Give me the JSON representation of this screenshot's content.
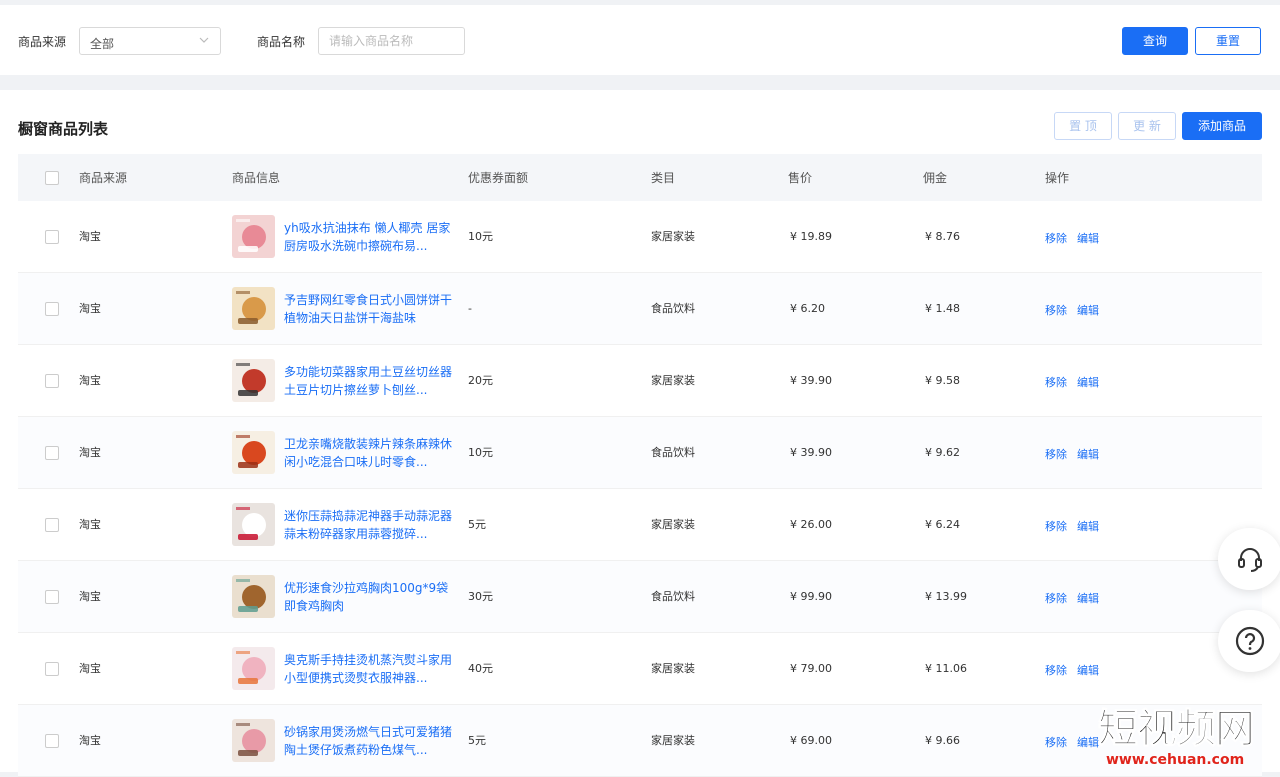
{
  "filter": {
    "source_label": "商品来源",
    "source_value": "全部",
    "name_label": "商品名称",
    "name_placeholder": "请输入商品名称",
    "query_button": "查询",
    "reset_button": "重置"
  },
  "list": {
    "title": "橱窗商品列表",
    "pin_button": "置 顶",
    "update_button": "更 新",
    "add_button": "添加商品"
  },
  "table": {
    "headers": [
      "商品来源",
      "商品信息",
      "优惠券面额",
      "类目",
      "售价",
      "佣金",
      "操作"
    ],
    "rows": [
      {
        "source": "淘宝",
        "name": "yh吸水抗油抹布 懒人椰壳 居家厨房吸水洗碗巾擦碗布易...",
        "coupon": "10元",
        "category": "家居家装",
        "price": "¥ 19.89",
        "commission": "¥ 8.76",
        "remove": "移除",
        "edit": "编辑"
      },
      {
        "source": "淘宝",
        "name": "予吉野网红零食日式小圆饼饼干植物油天日盐饼干海盐味",
        "coupon": "-",
        "category": "食品饮料",
        "price": "¥ 6.20",
        "commission": "¥ 1.48",
        "remove": "移除",
        "edit": "编辑"
      },
      {
        "source": "淘宝",
        "name": "多功能切菜器家用土豆丝切丝器土豆片切片擦丝萝卜刨丝...",
        "coupon": "20元",
        "category": "家居家装",
        "price": "¥ 39.90",
        "commission": "¥ 9.58",
        "remove": "移除",
        "edit": "编辑"
      },
      {
        "source": "淘宝",
        "name": "卫龙亲嘴烧散装辣片辣条麻辣休闲小吃混合口味儿时零食...",
        "coupon": "10元",
        "category": "食品饮料",
        "price": "¥ 39.90",
        "commission": "¥ 9.62",
        "remove": "移除",
        "edit": "编辑"
      },
      {
        "source": "淘宝",
        "name": "迷你压蒜捣蒜泥神器手动蒜泥器蒜末粉碎器家用蒜蓉搅碎...",
        "coupon": "5元",
        "category": "家居家装",
        "price": "¥ 26.00",
        "commission": "¥ 6.24",
        "remove": "移除",
        "edit": "编辑"
      },
      {
        "source": "淘宝",
        "name": "优形速食沙拉鸡胸肉100g*9袋即食鸡胸肉",
        "coupon": "30元",
        "category": "食品饮料",
        "price": "¥ 99.90",
        "commission": "¥ 13.99",
        "remove": "移除",
        "edit": "编辑"
      },
      {
        "source": "淘宝",
        "name": "奥克斯手持挂烫机蒸汽熨斗家用小型便携式烫熨衣服神器...",
        "coupon": "40元",
        "category": "家居家装",
        "price": "¥ 79.00",
        "commission": "¥ 11.06",
        "remove": "移除",
        "edit": "编辑"
      },
      {
        "source": "淘宝",
        "name": "砂锅家用煲汤燃气日式可爱猪猪陶土煲仔饭煮药粉色煤气...",
        "coupon": "5元",
        "category": "家居家装",
        "price": "¥ 69.00",
        "commission": "¥ 9.66",
        "remove": "移除",
        "edit": "编辑"
      }
    ]
  },
  "watermark": {
    "main": "短视频网",
    "sub": "www.cehuan.com"
  },
  "icons": [
    "chevron-down-icon",
    "headset-icon",
    "help-icon"
  ],
  "colors": {
    "primary": "#1a6ef5",
    "watermark_red": "#e0241b"
  }
}
